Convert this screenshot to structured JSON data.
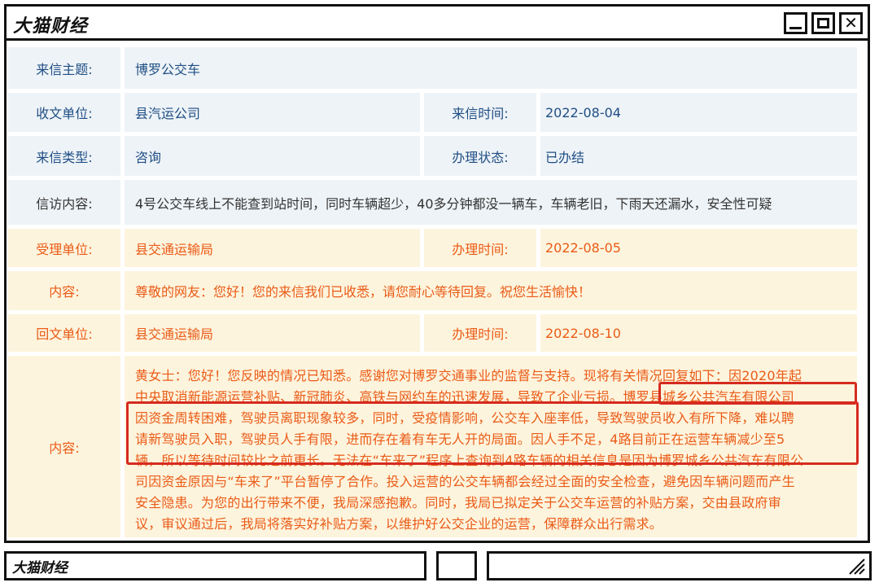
{
  "window": {
    "title": "大猫财经"
  },
  "letter": {
    "subject_label": "来信主题:",
    "subject": "博罗公交车",
    "recipient_label": "收文单位:",
    "recipient": "县汽运公司",
    "date_label": "来信时间:",
    "date": "2022-08-04",
    "type_label": "来信类型:",
    "type": "咨询",
    "status_label": "办理状态:",
    "status": "已办结",
    "content_label": "信访内容:",
    "content": "4号公交车线上不能查到站时间，同时车辆超少，40多分钟都没一辆车，车辆老旧，下雨天还漏水，安全性可疑"
  },
  "acceptance": {
    "unit_label": "受理单位:",
    "unit": "县交通运输局",
    "time_label": "办理时间:",
    "time": "2022-08-05",
    "content_label": "内容:",
    "content": "尊敬的网友：您好！您的来信我们已收悉，请您耐心等待回复。祝您生活愉快！"
  },
  "reply": {
    "unit_label": "回文单位:",
    "unit": "县交通运输局",
    "time_label": "办理时间:",
    "time": "2022-08-10",
    "content_label": "内容:",
    "lines": [
      "黄女士：您好！您反映的情况已知悉。感谢您对博罗交通事业的监督与支持。现将有关情况回复如下：因2020年起",
      "中央取消新能源运营补贴、新冠肺炎、高铁与网约车的迅速发展，导致了企业亏损。博罗县城乡公共汽车有限公司",
      "因资金周转困难，驾驶员离职现象较多，同时，受疫情影响，公交车入座率低，导致驾驶员收入有所下降，难以聘",
      "请新驾驶员入职，驾驶员人手有限，进而存在着有车无人开的局面。因人手不足，4路目前正在运营车辆减少至5",
      "辆，所以等待时间较比之前更长。无法在“车来了”程序上查询到4路车辆的相关信息是因为博罗城乡公共汽车有限公",
      "司因资金原因与“车来了”平台暂停了合作。投入运营的公交车辆都会经过全面的安全检查，避免因车辆问题而产生",
      "安全隐患。为您的出行带来不便，我局深感抱歉。同时，我局已拟定关于公交车运营的补贴方案，交由县政府审",
      "议，审议通过后，我局将落实好补贴方案，以维护好公交企业的运营，保障群众出行需求。"
    ]
  },
  "taskbar": {
    "title": "大猫财经"
  },
  "colors": {
    "label_blue": "#1f4e84",
    "reply_orange": "#ea5b17",
    "blue_bg": "#eef3f7",
    "orange_bg": "#fdf4dd",
    "highlight_red": "#d62b1f"
  }
}
